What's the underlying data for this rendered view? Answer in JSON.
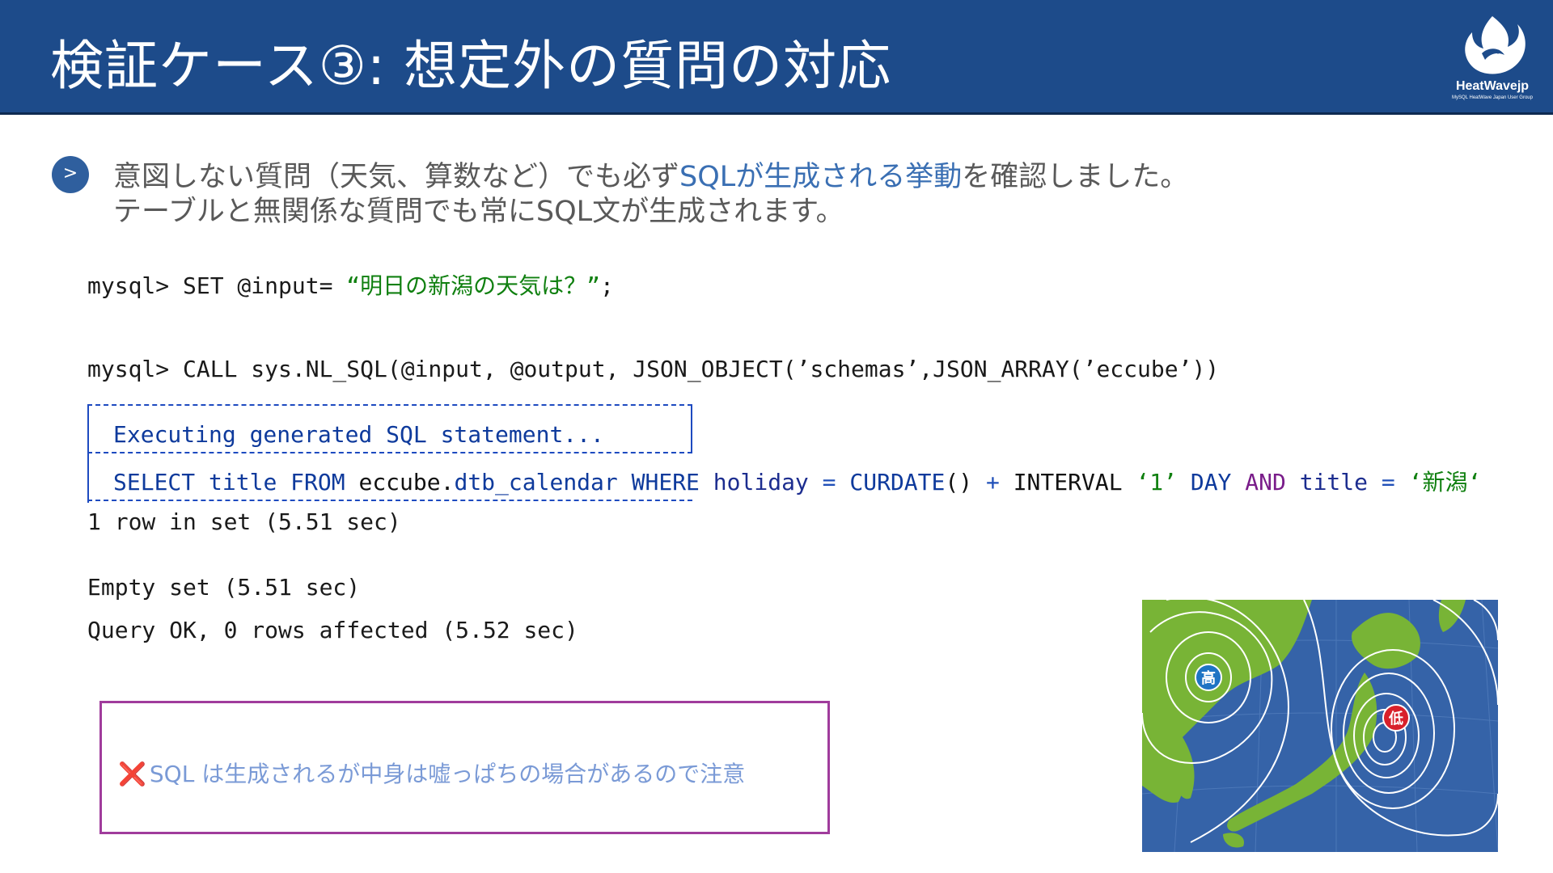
{
  "header": {
    "title": "検証ケース③: 想定外の質問の対応",
    "logo_name": "HeatWavejp",
    "logo_sub": "MySQL HeatWave Japan User Group"
  },
  "bullet": {
    "icon": ">",
    "line1_pre": "意図しない質問（天気、算数など）でも必ず",
    "line1_hl": "SQLが生成される挙動",
    "line1_post": "を確認しました。",
    "line2": "テーブルと無関係な質問でも常にSQL文が生成されます。"
  },
  "code": {
    "set_prompt": "mysql> SET @input= ",
    "set_value": "“明日の新潟の天気は？”",
    "set_end": ";",
    "call_line": "mysql> CALL sys.NL_SQL(@input, @output, JSON_OBJECT(’schemas’,JSON_ARRAY(’eccube’))",
    "exec_label": "Executing generated SQL statement...",
    "sql_select": "SELECT",
    "sql_title": " title ",
    "sql_from": "FROM",
    "sql_schema": " eccube.",
    "sql_table": "dtb_calendar",
    "sql_where": " WHERE ",
    "sql_holiday": "holiday",
    "sql_eq1": " = ",
    "sql_curdate": "CURDATE",
    "sql_paren": "()",
    "sql_plus": " + ",
    "sql_interval": "INTERVAL  ",
    "sql_one": "‘1’",
    "sql_day": "  DAY ",
    "sql_and": "AND",
    "sql_title2": " title ",
    "sql_eq2": "=  ",
    "sql_val": "‘新潟‘",
    "row_line": "1 row in set (5.51 sec)",
    "empty_line": "Empty set (5.51 sec)",
    "query_line": "Query OK, 0 rows affected (5.52 sec)"
  },
  "note": {
    "icon": "❌",
    "text": "SQL は生成されるが中身は嘘っぱちの場合があるので注意"
  },
  "map": {
    "high_label": "高",
    "low_label": "低"
  }
}
